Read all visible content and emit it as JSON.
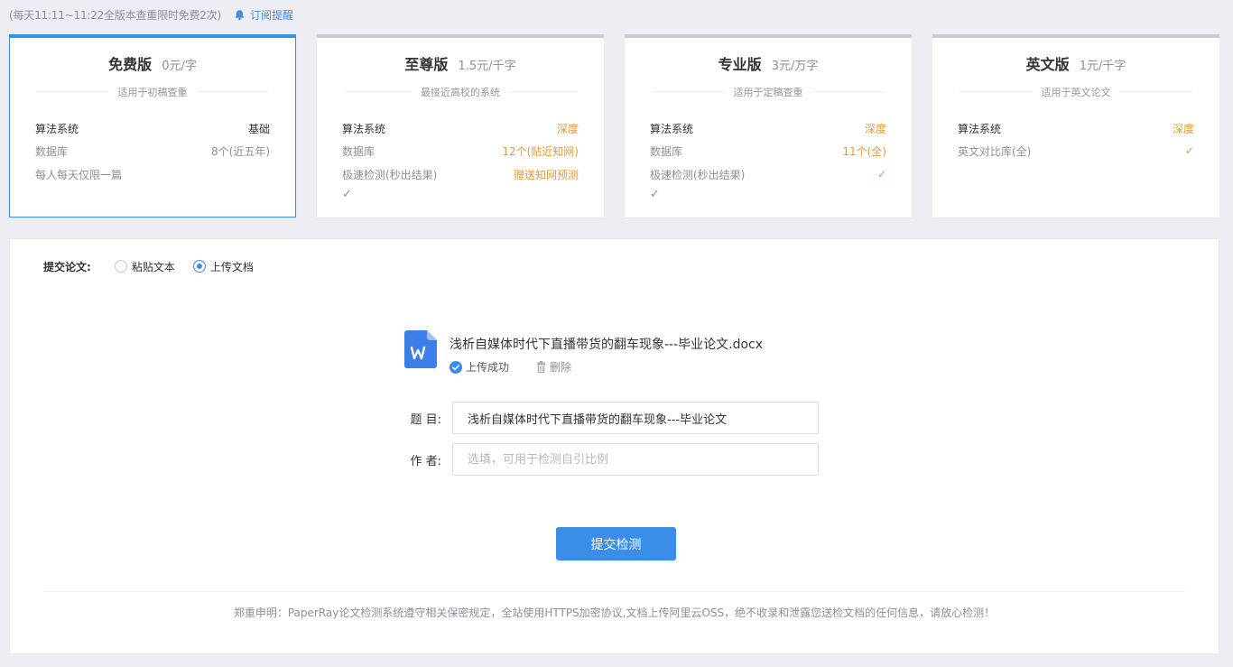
{
  "top": {
    "note": "(每天11:11~11:22全版本查重限时免费2次)",
    "subscribe_label": "订阅提醒"
  },
  "plans": [
    {
      "name": "免费版",
      "price": "0元/字",
      "desc": "适用于初稿查重",
      "features": [
        {
          "key": "算法系统",
          "value": "基础"
        },
        {
          "key": "数据库",
          "value": "8个(近五年)"
        },
        {
          "key": "每人每天仅限一篇",
          "value": ""
        }
      ]
    },
    {
      "name": "至尊版",
      "price": "1.5元/千字",
      "desc": "最接近高校的系统",
      "features": [
        {
          "key": "算法系统",
          "value": "深度"
        },
        {
          "key": "数据库",
          "value": "12个(贴近知网)"
        },
        {
          "key": "极速检测(秒出结果)",
          "value": "赠送知网预测"
        }
      ],
      "extra_tick": "✓"
    },
    {
      "name": "专业版",
      "price": "3元/万字",
      "desc": "适用于定稿查重",
      "features": [
        {
          "key": "算法系统",
          "value": "深度"
        },
        {
          "key": "数据库",
          "value": "11个(全)"
        },
        {
          "key": "极速检测(秒出结果)",
          "value": "✓"
        }
      ],
      "extra_tick": "✓"
    },
    {
      "name": "英文版",
      "price": "1元/千字",
      "desc": "适用于英文论文",
      "features": [
        {
          "key": "算法系统",
          "value": "深度"
        },
        {
          "key": "英文对比库(全)",
          "value": "✓"
        }
      ]
    }
  ],
  "form": {
    "submit_label": "提交论文:",
    "option_paste": "粘贴文本",
    "option_upload": "上传文档",
    "file_name": "浅析自媒体时代下直播带货的翻车现象---毕业论文.docx",
    "upload_status": "上传成功",
    "delete_label": "删除",
    "title_label": "题 目:",
    "title_value": "浅析自媒体时代下直播带货的翻车现象---毕业论文",
    "author_label": "作 者:",
    "author_placeholder": "选填，可用于检测自引比例",
    "submit_button": "提交检测",
    "footer": "郑重申明：PaperRay论文检测系统遵守相关保密规定，全站使用HTTPS加密协议,文档上传阿里云OSS，绝不收录和泄露您送检文档的任何信息，请放心检测！"
  },
  "colors": {
    "accent": "#3b8ee8",
    "orange": "#e49b3b",
    "word_icon": "#3b7ee8"
  },
  "icons": {
    "subscribe": "bell-icon",
    "file": "word-doc-icon",
    "status": "check-circle-icon",
    "delete": "trash-icon"
  }
}
